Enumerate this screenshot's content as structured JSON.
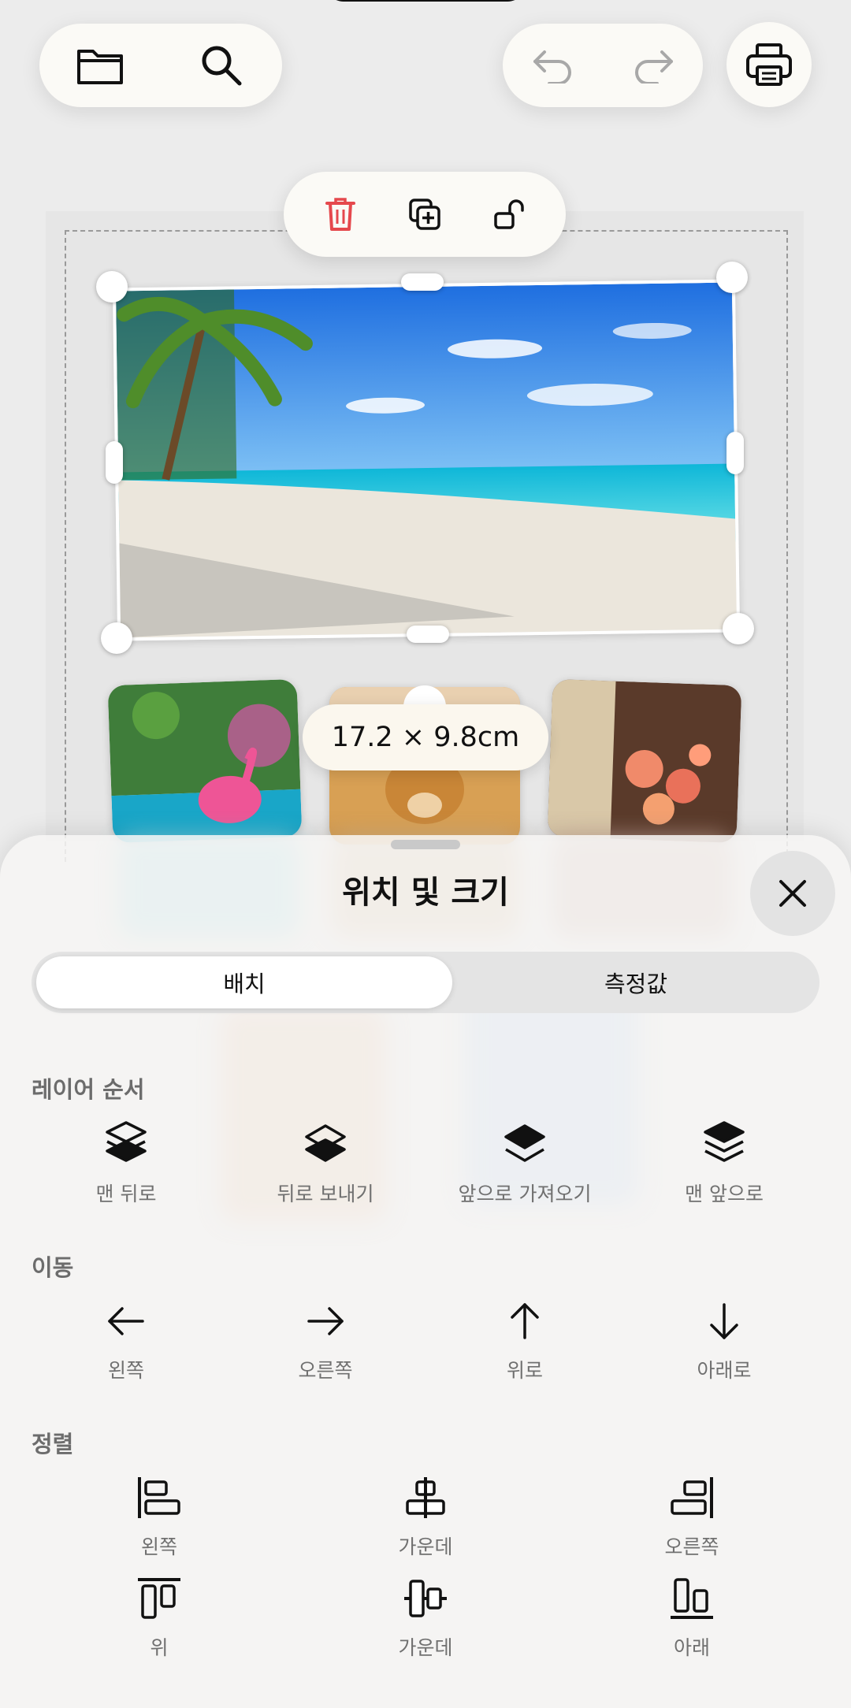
{
  "toolbar": {
    "folder_icon": "folder-icon",
    "search_icon": "search-icon",
    "undo_icon": "undo-icon",
    "redo_icon": "redo-icon",
    "print_icon": "printer-icon"
  },
  "floating_toolbar": {
    "delete_icon": "trash-icon",
    "duplicate_icon": "duplicate-icon",
    "lock_icon": "unlock-icon",
    "delete_color": "#e5484d"
  },
  "canvas": {
    "size_badge": "17.2 × 9.8cm"
  },
  "sheet": {
    "title": "위치 및 크기",
    "tabs": [
      {
        "label": "배치",
        "active": true
      },
      {
        "label": "측정값",
        "active": false
      }
    ],
    "layer_order": {
      "label": "레이어 순서",
      "items": [
        {
          "label": "맨 뒤로",
          "icon": "send-to-back-icon"
        },
        {
          "label": "뒤로 보내기",
          "icon": "send-backward-icon"
        },
        {
          "label": "앞으로 가져오기",
          "icon": "bring-forward-icon"
        },
        {
          "label": "맨 앞으로",
          "icon": "bring-to-front-icon"
        }
      ]
    },
    "move": {
      "label": "이동",
      "items": [
        {
          "label": "왼쪽",
          "icon": "arrow-left-icon"
        },
        {
          "label": "오른쪽",
          "icon": "arrow-right-icon"
        },
        {
          "label": "위로",
          "icon": "arrow-up-icon"
        },
        {
          "label": "아래로",
          "icon": "arrow-down-icon"
        }
      ]
    },
    "align": {
      "label": "정렬",
      "row1": [
        {
          "label": "왼쪽",
          "icon": "align-left-icon"
        },
        {
          "label": "가운데",
          "icon": "align-center-horizontal-icon"
        },
        {
          "label": "오른쪽",
          "icon": "align-right-icon"
        }
      ],
      "row2": [
        {
          "label": "위",
          "icon": "align-top-icon"
        },
        {
          "label": "가운데",
          "icon": "align-center-vertical-icon"
        },
        {
          "label": "아래",
          "icon": "align-bottom-icon"
        }
      ]
    }
  }
}
